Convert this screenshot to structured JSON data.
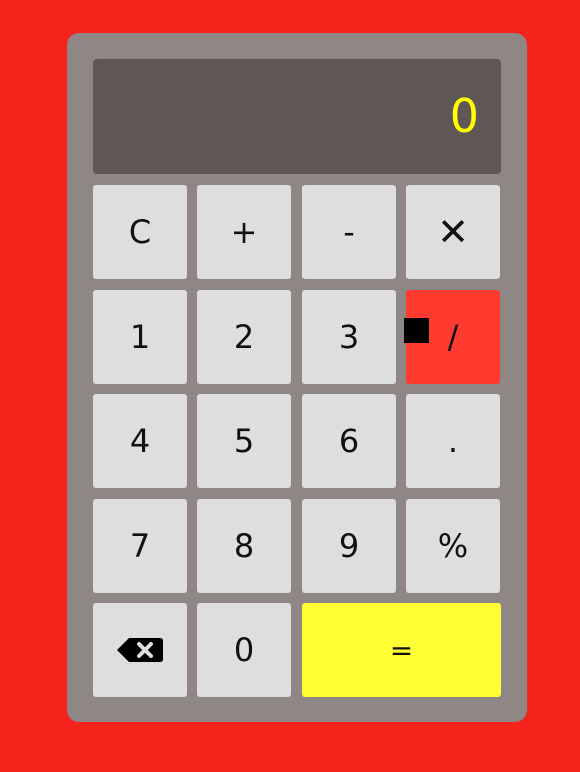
{
  "display": {
    "value": "0",
    "text_color": "#ffff00"
  },
  "keys": {
    "clear": "C",
    "plus": "+",
    "minus": "-",
    "multiply": "✕",
    "one": "1",
    "two": "2",
    "three": "3",
    "divide": "/",
    "four": "4",
    "five": "5",
    "six": "6",
    "decimal": ".",
    "seven": "7",
    "eight": "8",
    "nine": "9",
    "percent": "%",
    "backspace_icon": "backspace-icon",
    "zero": "0",
    "equals": "="
  },
  "state": {
    "active_operator": "divide"
  },
  "colors": {
    "page_background": "#f6221c",
    "body": "#8f8686",
    "display_background": "#5f5756",
    "key_background": "#dedede",
    "active_operator": "#ff3b30",
    "equals_background": "#ffff33"
  }
}
